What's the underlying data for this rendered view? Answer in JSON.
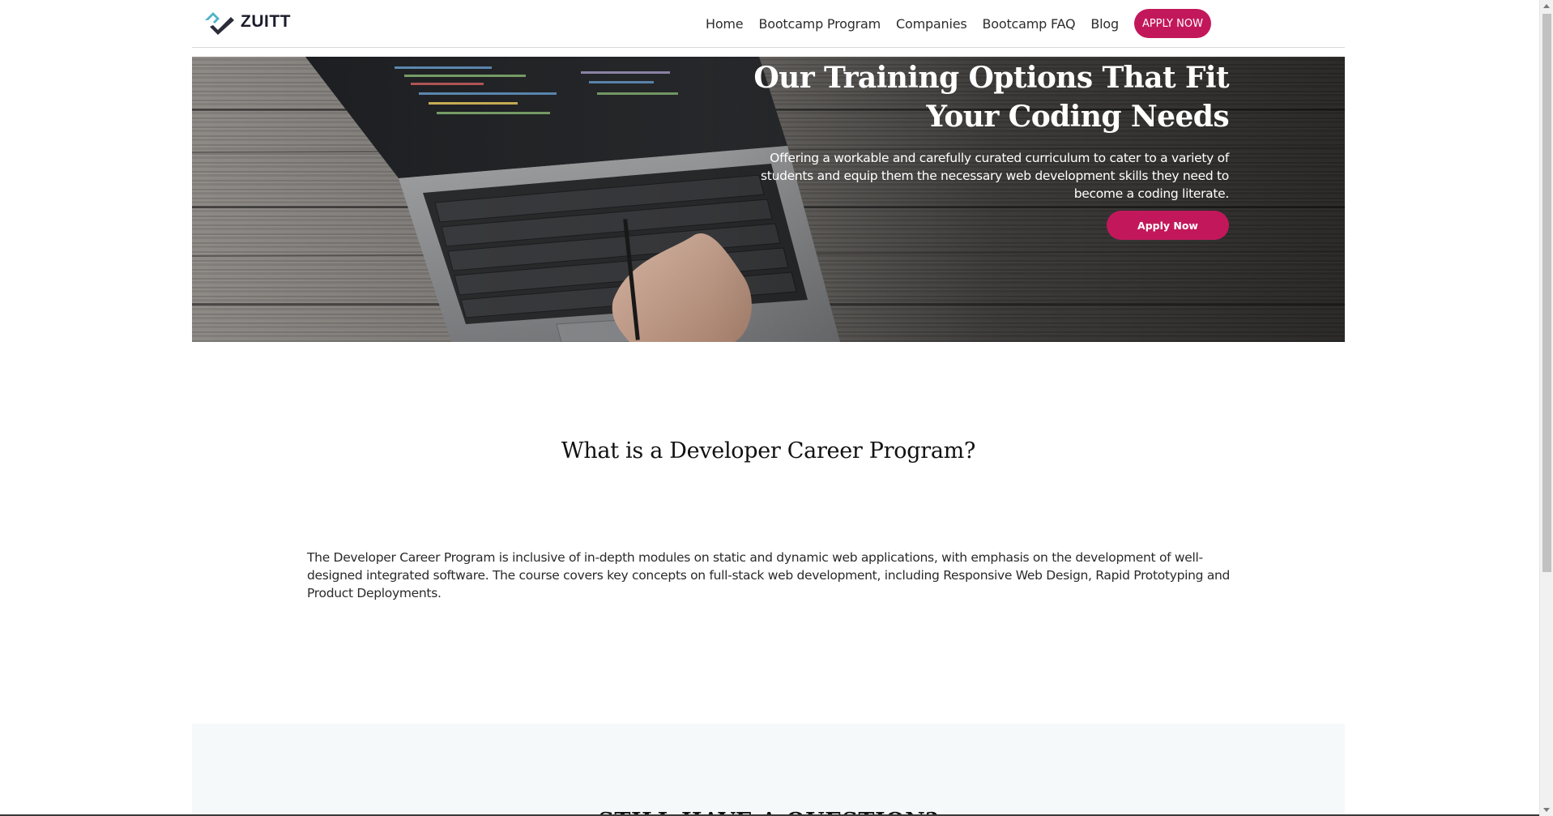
{
  "brand": {
    "name": "ZUITT",
    "accent_color": "#c2185b",
    "logo_colors": [
      "#4fb3c8",
      "#2b2b3a"
    ]
  },
  "nav": {
    "items": [
      {
        "label": "Home"
      },
      {
        "label": "Bootcamp Program"
      },
      {
        "label": "Companies"
      },
      {
        "label": "Bootcamp FAQ"
      },
      {
        "label": "Blog"
      }
    ],
    "cta_label": "APPLY NOW"
  },
  "hero": {
    "title": "Our Training Options That Fit Your Coding Needs",
    "subtitle": "Offering a workable and carefully curated curriculum to cater to a variety of students and equip them the necessary web development skills they need to become a coding literate.",
    "button_label": "Apply Now"
  },
  "program": {
    "title": "What is a Developer Career Program?",
    "body": "The Developer Career Program is inclusive of in-depth modules on static and dynamic web applications, with emphasis on the development of well-designed integrated software. The course covers key concepts on full-stack web development, including Responsive Web Design, Rapid Prototyping and Product Deployments."
  },
  "faq": {
    "title": "STILL HAVE A QUESTION?"
  }
}
